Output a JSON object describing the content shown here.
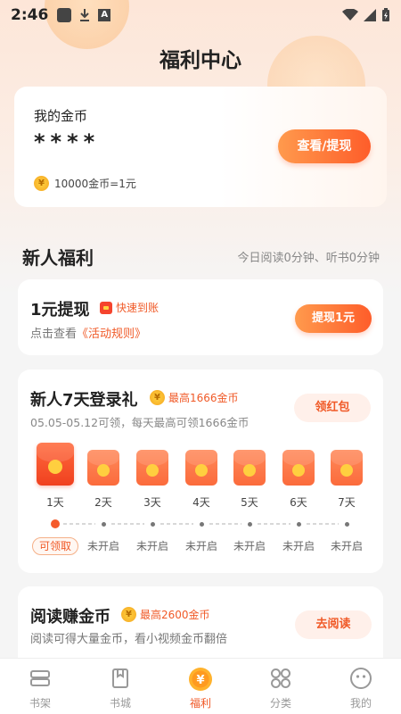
{
  "status_bar": {
    "time": "2:46"
  },
  "page": {
    "title": "福利中心"
  },
  "coins": {
    "label": "我的金币",
    "value": "****",
    "button": "查看/提现",
    "rate": "10000金币=1元"
  },
  "section": {
    "title": "新人福利",
    "subtitle": "今日阅读0分钟、听书0分钟"
  },
  "withdraw": {
    "title": "1元提现",
    "tag": "快速到账",
    "desc_prefix": "点击查看",
    "rule_link": "《活动规则》",
    "button": "提现1元"
  },
  "newbie": {
    "title": "新人7天登录礼",
    "tag": "最高1666金币",
    "desc": "05.05-05.12可领，每天最高可领1666金币",
    "button": "领红包",
    "days": [
      "1天",
      "2天",
      "3天",
      "4天",
      "5天",
      "6天",
      "7天"
    ],
    "statuses": [
      "可领取",
      "未开启",
      "未开启",
      "未开启",
      "未开启",
      "未开启",
      "未开启"
    ]
  },
  "reading": {
    "title": "阅读赚金币",
    "tag": "最高2600金币",
    "desc": "阅读可得大量金币，看小视频金币翻倍",
    "button": "去阅读"
  },
  "tabs": [
    {
      "label": "书架",
      "icon": "bookshelf-icon"
    },
    {
      "label": "书城",
      "icon": "book-icon"
    },
    {
      "label": "福利",
      "icon": "coin-icon",
      "active": true
    },
    {
      "label": "分类",
      "icon": "grid-icon"
    },
    {
      "label": "我的",
      "icon": "profile-icon"
    }
  ],
  "colors": {
    "accent": "#fe5d2a",
    "accent_light": "#ff9a4d"
  }
}
